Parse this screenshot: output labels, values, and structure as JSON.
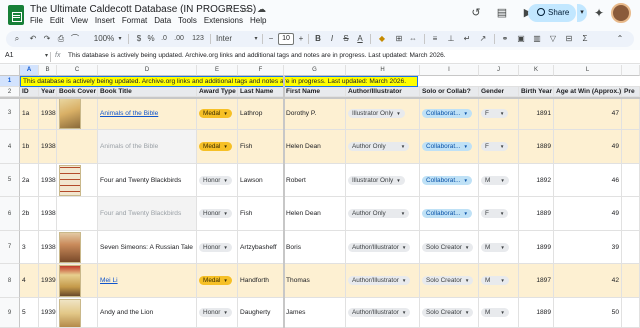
{
  "app": {
    "title": "The Ultimate Caldecott Database (IN PROGRESS)",
    "menu": [
      "File",
      "Edit",
      "View",
      "Insert",
      "Format",
      "Data",
      "Tools",
      "Extensions",
      "Help"
    ],
    "share_label": "Share"
  },
  "toolbar": {
    "zoom": "100%",
    "currency": "$",
    "percent": "%",
    "dec_decrease": ".0",
    "dec_increase": ".00",
    "number_format": "123",
    "font": "Inter",
    "font_size": "10",
    "bold": "B",
    "italic": "I",
    "strike": "S",
    "text_color": "A"
  },
  "formula": {
    "cell_ref": "A1",
    "fx": "fx",
    "content": "This database is actively being updated. Archive.org links and additional tags and notes are in progress. Last updated: March 2026."
  },
  "columns": [
    "A",
    "B",
    "C",
    "D",
    "E",
    "F",
    "G",
    "H",
    "I",
    "J",
    "K",
    "L"
  ],
  "rows": [
    {
      "num": "1",
      "banner": "This database is actively being updated. Archive.org links and additional tags and notes are in progress. Last updated: March 2026."
    },
    {
      "num": "2",
      "header": [
        "ID",
        "Year",
        "Book Cover",
        "Book Title",
        "Award Type",
        "Last Name",
        "First Name",
        "Author/Illustrator",
        "Solo or Collab?",
        "Gender",
        "Birth Year",
        "Age at Win (Approx.)",
        "Pre"
      ]
    },
    {
      "num": "3",
      "id": "1a",
      "year": "1938",
      "title": "Animals of the Bible",
      "award": "Medal",
      "last": "Lathrop",
      "first": "Dorothy P.",
      "role": "Illustrator Only",
      "collab": "Collaborat...",
      "gender": "F",
      "birth": "1891",
      "age": "47"
    },
    {
      "num": "4",
      "id": "1b",
      "year": "1938",
      "title": "Animals of the Bible",
      "award": "Medal",
      "last": "Fish",
      "first": "Helen Dean",
      "role": "Author Only",
      "collab": "Collaborat...",
      "gender": "F",
      "birth": "1889",
      "age": "49"
    },
    {
      "num": "5",
      "id": "2a",
      "year": "1938",
      "title": "Four and Twenty Blackbirds",
      "award": "Honor",
      "last": "Lawson",
      "first": "Robert",
      "role": "Illustrator Only",
      "collab": "Collaborat...",
      "gender": "M",
      "birth": "1892",
      "age": "46"
    },
    {
      "num": "6",
      "id": "2b",
      "year": "1938",
      "title": "Four and Twenty Blackbirds",
      "award": "Honor",
      "last": "Fish",
      "first": "Helen Dean",
      "role": "Author Only",
      "collab": "Collaborat...",
      "gender": "F",
      "birth": "1889",
      "age": "49"
    },
    {
      "num": "7",
      "id": "3",
      "year": "1938",
      "title": "Seven Simeons: A Russian Tale",
      "award": "Honor",
      "last": "Artzybasheff",
      "first": "Boris",
      "role": "Author/Illustrator",
      "collab": "Solo Creator",
      "gender": "M",
      "birth": "1899",
      "age": "39"
    },
    {
      "num": "8",
      "id": "4",
      "year": "1939",
      "title": "Mei Li",
      "award": "Medal",
      "last": "Handforth",
      "first": "Thomas",
      "role": "Author/Illustrator",
      "collab": "Solo Creator",
      "gender": "M",
      "birth": "1897",
      "age": "42"
    },
    {
      "num": "9",
      "id": "5",
      "year": "1939",
      "title": "Andy and the Lion",
      "award": "Honor",
      "last": "Daugherty",
      "first": "James",
      "role": "Author/Illustrator",
      "collab": "Solo Creator",
      "gender": "M",
      "birth": "1889",
      "age": "50"
    }
  ]
}
